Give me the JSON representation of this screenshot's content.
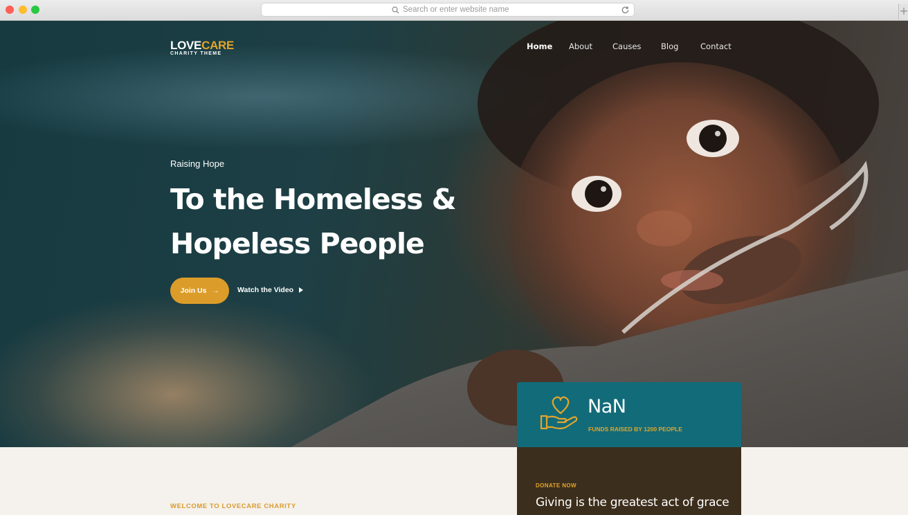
{
  "browser": {
    "url_placeholder": "Search or enter website name"
  },
  "brand": {
    "part1": "LOVE",
    "part2": "CARE",
    "tagline": "CHARITY THEME"
  },
  "nav": {
    "items": [
      {
        "label": "Home",
        "active": true
      },
      {
        "label": "About",
        "active": false
      },
      {
        "label": "Causes",
        "active": false
      },
      {
        "label": "Blog",
        "active": false
      },
      {
        "label": "Contact",
        "active": false
      }
    ]
  },
  "hero": {
    "eyebrow": "Raising Hope",
    "headline_line1": "To the Homeless &",
    "headline_line2": "Hopeless People",
    "join_label": "Join Us",
    "join_arrow": "→",
    "watch_label": "Watch the Video"
  },
  "funds": {
    "amount": "NaN",
    "caption": "FUNDS RAISED BY 1200 PEOPLE"
  },
  "welcome": {
    "label": "WELCOME TO LOVECARE CHARITY"
  },
  "donate": {
    "eyebrow": "DONATE NOW",
    "title": "Giving is the greatest act of grace"
  },
  "colors": {
    "accent": "#dc9c29",
    "teal_card": "#126b78",
    "brown_card": "#3c2e1c",
    "page_bg": "#f5f1ec"
  }
}
